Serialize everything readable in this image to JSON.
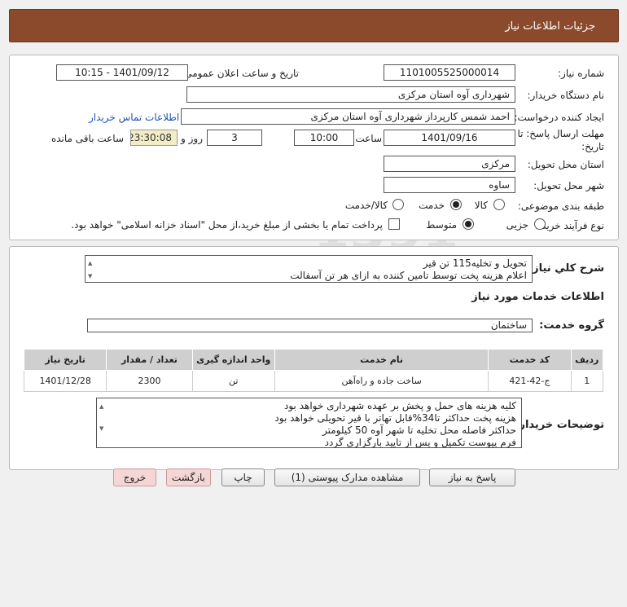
{
  "header": {
    "title": "جزئیات اطلاعات نیاز"
  },
  "form": {
    "need_number_label": "شماره نیاز:",
    "need_number": "1101005525000014",
    "announce_label": "تاریخ و ساعت اعلان عمومی:",
    "announce_value": "1401/09/12 - 10:15",
    "buyer_label": "نام دستگاه خریدار:",
    "buyer_value": "شهرداری آوه استان مرکزی",
    "creator_label": "ایجاد کننده درخواست:",
    "creator_value": "احمد  شمس کارپرداز شهرداری آوه استان مرکزی",
    "contact_link": "اطلاعات تماس خریدار",
    "deadline_label_1": "مهلت ارسال پاسخ: تا",
    "deadline_label_2": "تاریخ:",
    "deadline_date": "1401/09/16",
    "time_label": "ساعت",
    "deadline_time": "10:00",
    "days_value": "3",
    "days_label": "روز و",
    "remaining_time": "23:30:08",
    "remaining_label": "ساعت باقی مانده",
    "province_label": "استان محل تحویل:",
    "province_value": "مرکزی",
    "city_label": "شهر محل تحویل:",
    "city_value": "ساوه",
    "category_label": "طبقه بندی موضوعی:",
    "category_options": [
      "کالا",
      "خدمت",
      "کالا/خدمت"
    ],
    "category_selected": "خدمت",
    "process_label": "نوع فرآیند خرید :",
    "process_options": [
      "جزیی",
      "متوسط"
    ],
    "process_selected": "متوسط",
    "payment_note": "پرداخت تمام یا بخشی از مبلغ خرید،از محل \"اسناد خزانه اسلامی\" خواهد بود."
  },
  "description": {
    "label": "شرح کلي نياز:",
    "lines": [
      "تحویل و تخلیه115 تن قیر",
      "اعلام هزینه پخت توسط تامین کننده به ازای هر تن آسفالت"
    ]
  },
  "services": {
    "section_title": "اطلاعات خدمات مورد نیاز",
    "group_label": "گروه خدمت:",
    "group_value": "ساختمان",
    "columns": [
      "ردیف",
      "کد خدمت",
      "نام خدمت",
      "واحد اندازه گیری",
      "تعداد / مقدار",
      "تاریخ نیاز"
    ],
    "rows": [
      [
        "1",
        "ج-42-421",
        "ساخت جاده و راه‌آهن",
        "تن",
        "2300",
        "1401/12/28"
      ]
    ]
  },
  "buyer_notes": {
    "label": "توضیحات خریدار:",
    "lines": [
      "کلیه هزینه های حمل و پخش بر عهده شهرداری خواهد بود",
      "هزینه پخت حداکثر تا34%قابل تهاتر با قیر تحویلی خواهد بود",
      "حداکثر فاصله محل تخلیه تا شهر آوه 50 کیلومتر",
      "فرم پیوست تکمیل و پس از تایید بارگزاری گردد"
    ]
  },
  "buttons": {
    "reply": "پاسخ به نیاز",
    "attachments": "مشاهده مدارک پیوستی (1)",
    "print": "چاپ",
    "back": "بازگشت",
    "exit": "خروج"
  },
  "colors": {
    "header_bg": "#8b4a2b",
    "link": "#1a55b5",
    "remaining_bg": "#f3ecc5"
  }
}
